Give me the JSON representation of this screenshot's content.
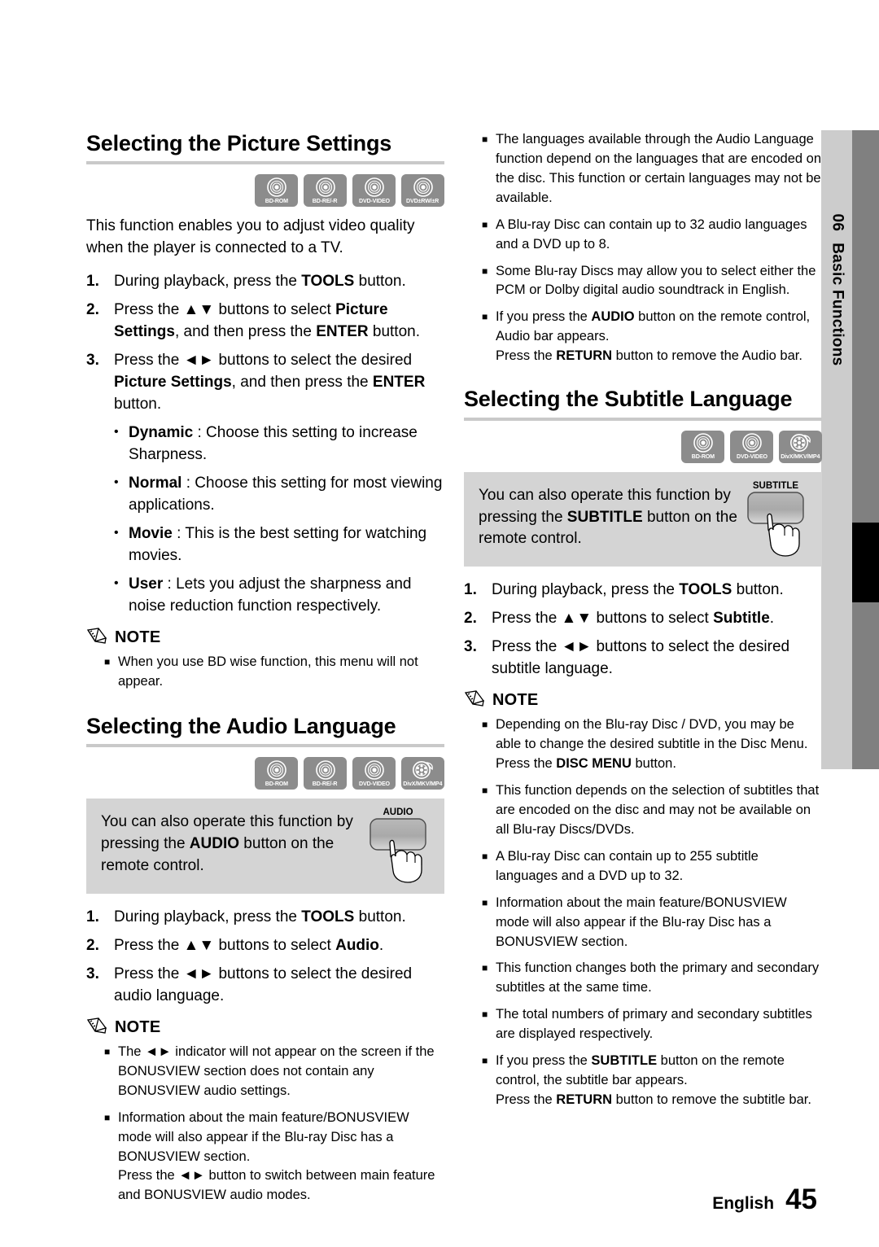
{
  "page": {
    "chapter_number": "06",
    "chapter_title": "Basic Functions",
    "footer_language": "English",
    "footer_page": "45",
    "note_word": "NOTE",
    "colors": {
      "rule": "#c9c9c9",
      "callout_bg": "#d4d4d4",
      "badge_bg": "#8c8c8c",
      "tab_light": "#cccccc",
      "tab_dark": "#808080",
      "tab_marker": "#000000"
    }
  },
  "picture_settings": {
    "title": "Selecting the Picture Settings",
    "discs": [
      {
        "label": "BD-ROM",
        "icon": "disc-icon"
      },
      {
        "label": "BD-RE/-R",
        "icon": "disc-icon"
      },
      {
        "label": "DVD-VIDEO",
        "icon": "disc-icon"
      },
      {
        "label": "DVD±RW/±R",
        "icon": "disc-icon"
      }
    ],
    "intro": "This function enables you to adjust video quality when the player is connected to a TV.",
    "steps": [
      {
        "num": "1.",
        "text_html": "During playback, press the <b>TOOLS</b> button."
      },
      {
        "num": "2.",
        "text_html": "Press the <span class=\"arrows\">▲▼</span> buttons to select <b>Picture Settings</b>, and then press the <b>ENTER</b> button."
      },
      {
        "num": "3.",
        "text_html": "Press the <span class=\"arrows\">◄►</span> buttons to select the desired <b>Picture Settings</b>, and then press the <b>ENTER</b> button."
      }
    ],
    "options": [
      {
        "name": "Dynamic",
        "desc": " : Choose this setting to increase Sharpness."
      },
      {
        "name": "Normal",
        "desc": " : Choose this setting for most viewing applications."
      },
      {
        "name": "Movie",
        "desc": " : This is the best setting for watching movies."
      },
      {
        "name": "User",
        "desc": " : Lets you adjust the sharpness and noise reduction function respectively."
      }
    ],
    "notes": [
      "When you use BD wise function, this menu will not appear."
    ]
  },
  "audio_language": {
    "title": "Selecting the Audio Language",
    "discs": [
      {
        "label": "BD-ROM",
        "icon": "disc-icon"
      },
      {
        "label": "BD-RE/-R",
        "icon": "disc-icon"
      },
      {
        "label": "DVD-VIDEO",
        "icon": "disc-icon"
      },
      {
        "label": "DivX/MKV/MP4",
        "icon": "film-reel-icon"
      }
    ],
    "callout_html": "You can also operate this function by pressing the <b>AUDIO</b> button on the remote control.",
    "remote_button_label": "AUDIO",
    "steps": [
      {
        "num": "1.",
        "text_html": "During playback, press the <b>TOOLS</b> button."
      },
      {
        "num": "2.",
        "text_html": "Press the <span class=\"arrows\">▲▼</span> buttons to select <b>Audio</b>."
      },
      {
        "num": "3.",
        "text_html": "Press the <span class=\"arrows\">◄►</span> buttons to select the desired audio language."
      }
    ],
    "notes_html": [
      "The <span class=\"arrows\">◄►</span> indicator will not appear on the screen if the BONUSVIEW section does not contain any BONUSVIEW audio settings.",
      "Information about the main feature/BONUSVIEW mode will also appear if the Blu-ray Disc has a BONUSVIEW section.<br>Press the <span class=\"arrows\">◄►</span> button to switch between main feature and BONUSVIEW audio modes."
    ]
  },
  "audio_top_notes_html": [
    "The languages available through the Audio Language function depend on the languages that are encoded on the disc. This function or certain languages may not be available.",
    "A Blu-ray Disc can contain up to 32 audio languages and a DVD up to 8.",
    "Some Blu-ray Discs may allow you to select either the PCM or Dolby digital audio soundtrack in English.",
    "If you press the <b>AUDIO</b> button on the remote control, Audio bar appears.<br>Press the <b>RETURN</b> button to remove the Audio bar."
  ],
  "subtitle_language": {
    "title": "Selecting the Subtitle Language",
    "discs": [
      {
        "label": "BD-ROM",
        "icon": "disc-icon"
      },
      {
        "label": "DVD-VIDEO",
        "icon": "disc-icon"
      },
      {
        "label": "DivX/MKV/MP4",
        "icon": "film-reel-icon"
      }
    ],
    "callout_html": "You can also operate this function by pressing the <b>SUBTITLE</b> button on the remote control.",
    "remote_button_label": "SUBTITLE",
    "steps": [
      {
        "num": "1.",
        "text_html": "During playback, press the <b>TOOLS</b> button."
      },
      {
        "num": "2.",
        "text_html": "Press the <span class=\"arrows\">▲▼</span> buttons to select <b>Subtitle</b>."
      },
      {
        "num": "3.",
        "text_html": "Press the <span class=\"arrows\">◄►</span> buttons to select the desired subtitle language."
      }
    ],
    "notes_html": [
      "Depending on the Blu-ray Disc / DVD, you may be able to change the desired subtitle in the Disc Menu. Press the <b>DISC MENU</b> button.",
      "This function depends on the selection of subtitles that are encoded on the disc and may not be available on all Blu-ray Discs/DVDs.",
      "A Blu-ray Disc can contain up to 255 subtitle languages and a DVD up to 32.",
      "Information about the main feature/BONUSVIEW mode will also appear if the Blu-ray Disc has a BONUSVIEW section.",
      "This function changes both the primary and secondary subtitles at the same time.",
      "The total numbers of primary and secondary subtitles are displayed respectively.",
      "If you press the <b>SUBTITLE</b> button on the remote control, the subtitle bar appears.<br>Press the <b>RETURN</b> button to remove the subtitle bar."
    ]
  }
}
